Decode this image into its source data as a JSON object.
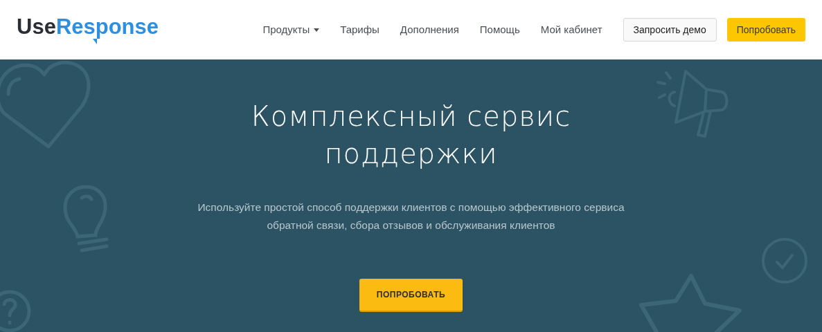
{
  "logo": {
    "dark": "Use",
    "accent": "Response"
  },
  "nav": [
    {
      "label": "Продукты",
      "dropdown": true
    },
    {
      "label": "Тарифы",
      "dropdown": false
    },
    {
      "label": "Дополнения",
      "dropdown": false
    },
    {
      "label": "Помощь",
      "dropdown": false
    },
    {
      "label": "Мой кабинет",
      "dropdown": false
    }
  ],
  "header_buttons": [
    {
      "label": "Запросить демо",
      "kind": "outline"
    },
    {
      "label": "Попробовать",
      "kind": "primary"
    }
  ],
  "hero": {
    "title": "Комплексный сервис поддержки",
    "subtitle": "Используйте простой способ поддержки клиентов с помощью эффективного сервиса обратной связи, сбора отзывов и обслуживания клиентов",
    "cta": "ПОПРОБОВАТЬ"
  }
}
